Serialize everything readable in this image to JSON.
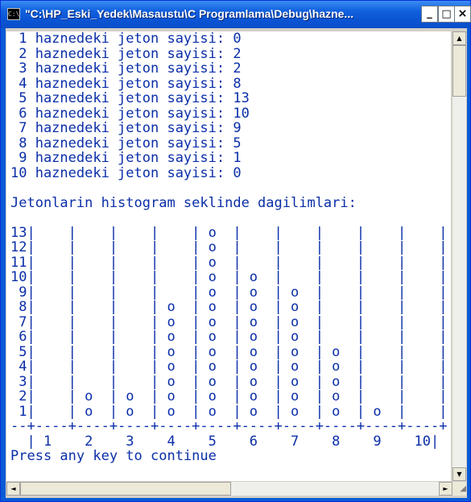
{
  "window": {
    "title": "\"C:\\HP_Eski_Yedek\\Masaustu\\C Programlama\\Debug\\hazne...",
    "icon_label": "C:\\",
    "buttons": {
      "minimize": "_",
      "maximize": "□",
      "close": "×"
    }
  },
  "console": {
    "output": " 1 haznedeki jeton sayisi: 0\n 2 haznedeki jeton sayisi: 2\n 3 haznedeki jeton sayisi: 2\n 4 haznedeki jeton sayisi: 8\n 5 haznedeki jeton sayisi: 13\n 6 haznedeki jeton sayisi: 10\n 7 haznedeki jeton sayisi: 9\n 8 haznedeki jeton sayisi: 5\n 9 haznedeki jeton sayisi: 1\n10 haznedeki jeton sayisi: 0\n\nJetonlarin histogram seklinde dagilimlari:\n\n13|    |    |    |    | o  |    |    |    |    |    |\n12|    |    |    |    | o  |    |    |    |    |    |\n11|    |    |    |    | o  |    |    |    |    |    |\n10|    |    |    |    | o  | o  |    |    |    |    |\n 9|    |    |    |    | o  | o  | o  |    |    |    |\n 8|    |    |    | o  | o  | o  | o  |    |    |    |\n 7|    |    |    | o  | o  | o  | o  |    |    |    |\n 6|    |    |    | o  | o  | o  | o  |    |    |    |\n 5|    |    |    | o  | o  | o  | o  | o  |    |    |\n 4|    |    |    | o  | o  | o  | o  | o  |    |    |\n 3|    |    |    | o  | o  | o  | o  | o  |    |    |\n 2|    | o  | o  | o  | o  | o  | o  | o  |    |    |\n 1|    | o  | o  | o  | o  | o  | o  | o  | o  |    |\n--+----+----+----+----+----+----+----+----+----+----+\n  | 1    2    3    4    5    6    7    8    9    10|\nPress any key to continue"
  },
  "scrollbars": {
    "up": "▲",
    "down": "▼",
    "left": "◄",
    "right": "►",
    "grip": "◢"
  }
}
